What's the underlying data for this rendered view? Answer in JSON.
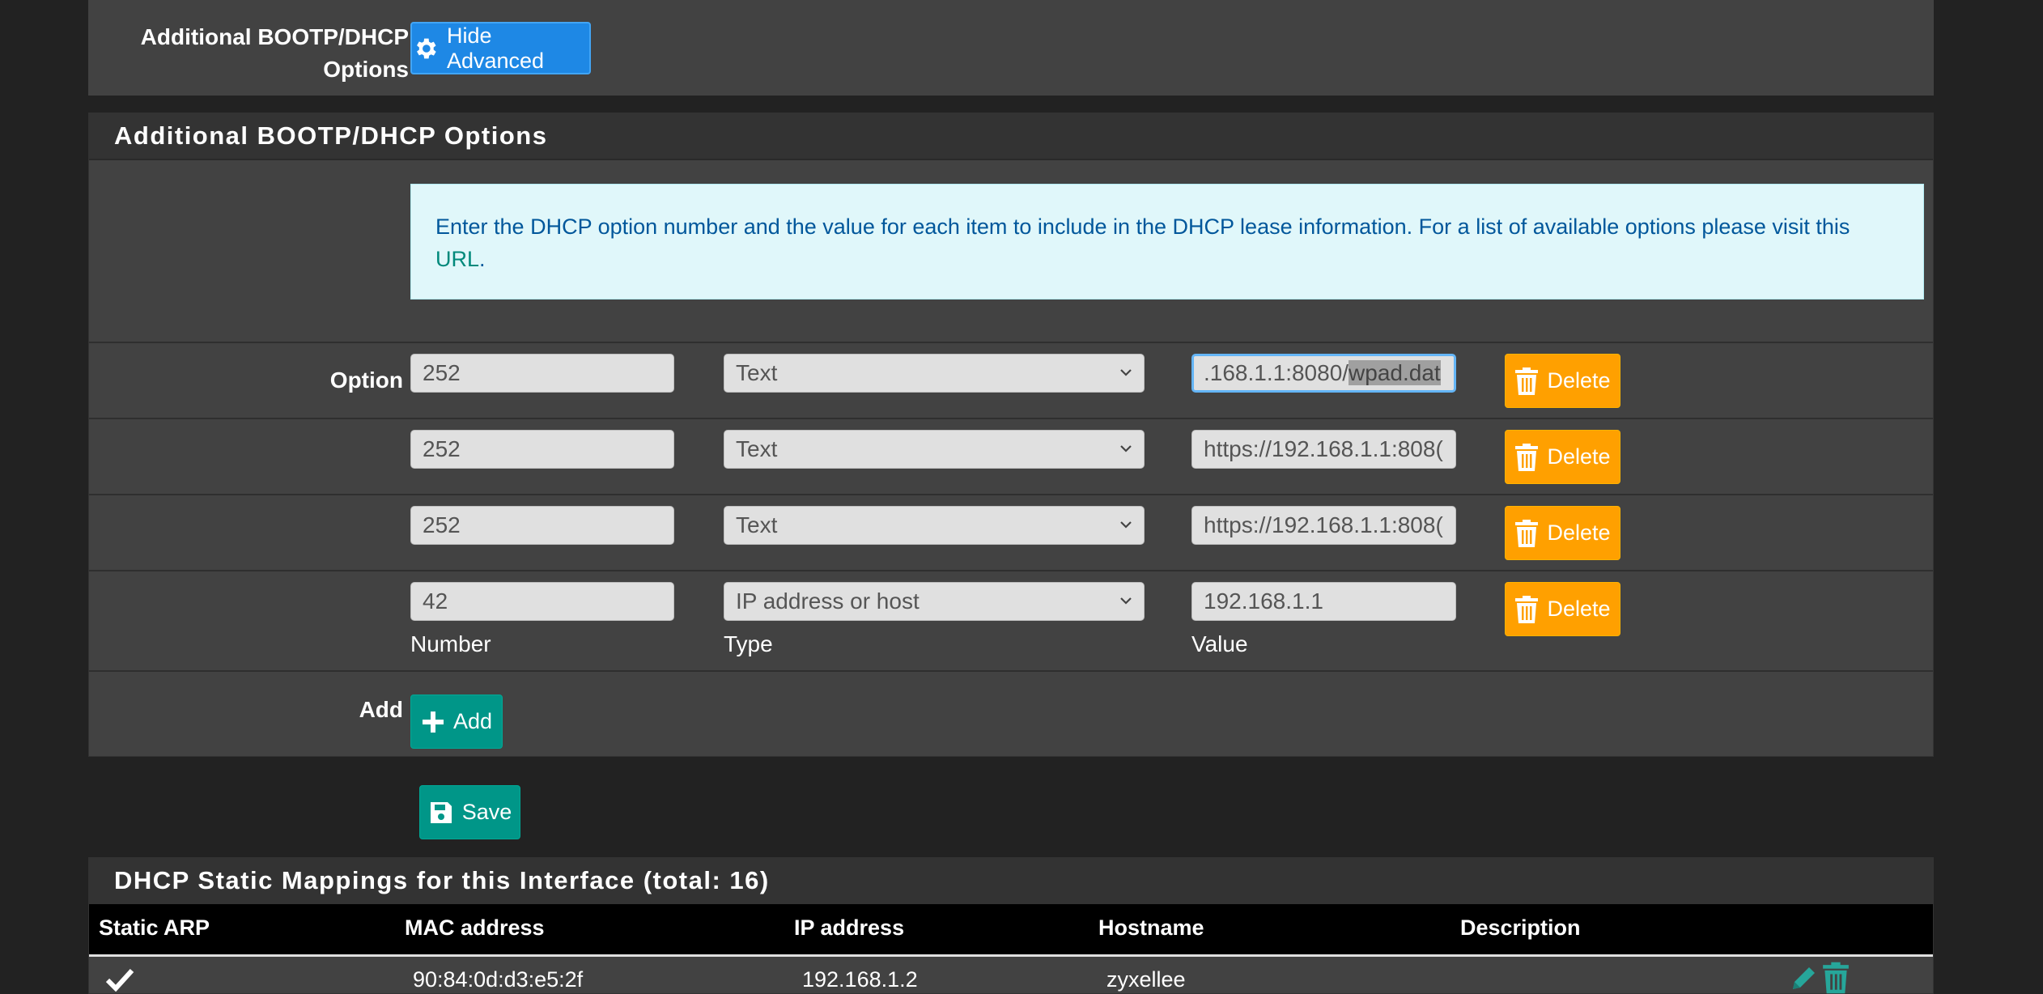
{
  "advanced": {
    "label": "Additional BOOTP/DHCP Options",
    "hide_button": "Hide Advanced"
  },
  "panel": {
    "title": "Additional BOOTP/DHCP Options",
    "info_text": "Enter the DHCP option number and the value for each item to include in the DHCP lease information. For a list of available options please visit this ",
    "info_link": "URL",
    "info_end": "."
  },
  "options": {
    "row_label": "Option",
    "rows": [
      {
        "number": "252",
        "type": "Text",
        "value_prefix": ".168.1.1:8080/",
        "value_selected": "wpad.dat",
        "delete": "Delete"
      },
      {
        "number": "252",
        "type": "Text",
        "value": "https://192.168.1.1:808(",
        "delete": "Delete"
      },
      {
        "number": "252",
        "type": "Text",
        "value": "https://192.168.1.1:808(",
        "delete": "Delete"
      },
      {
        "number": "42",
        "type": "IP address or host",
        "value": "192.168.1.1",
        "delete": "Delete"
      }
    ],
    "col_number": "Number",
    "col_type": "Type",
    "col_value": "Value"
  },
  "add": {
    "label": "Add",
    "button": "Add"
  },
  "save": {
    "button": "Save"
  },
  "mappings": {
    "title": "DHCP Static Mappings for this Interface (total: 16)",
    "headers": [
      "Static ARP",
      "MAC address",
      "IP address",
      "Hostname",
      "Description"
    ],
    "rows": [
      {
        "static_arp": "checkmark-icon",
        "mac": "90:84:0d:d3:e5:2f",
        "ip": "192.168.1.2",
        "hostname": "zyxellee",
        "description": ""
      }
    ]
  },
  "colors": {
    "background": "#222222",
    "panel": "#424242",
    "panel_header": "#333333",
    "delete_orange": "#ffa000",
    "add_teal": "#009688",
    "hide_blue": "#1e88e5",
    "info_bg": "#e0f7fa",
    "info_text": "#01579b"
  }
}
